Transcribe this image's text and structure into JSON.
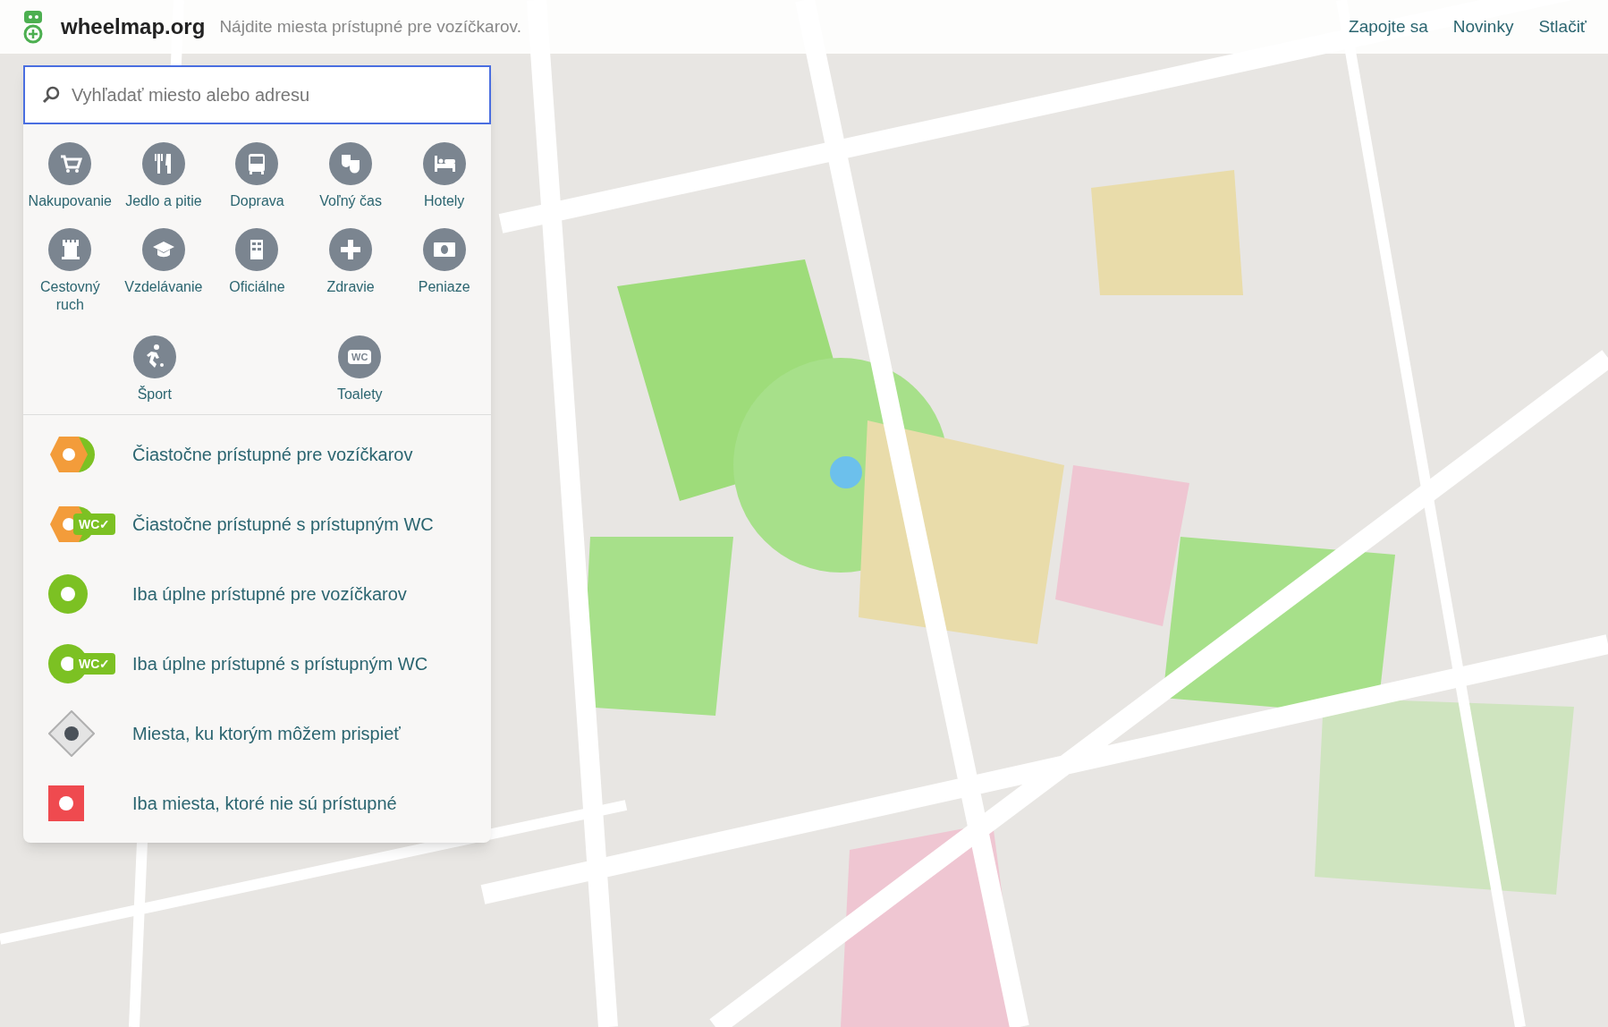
{
  "header": {
    "logo": "wheelmap.org",
    "tagline": "Nájdite miesta prístupné pre vozíčkarov.",
    "nav": [
      "Zapojte sa",
      "Novinky",
      "Stlačiť"
    ]
  },
  "search": {
    "placeholder": "Vyhľadať miesto alebo adresu"
  },
  "categories": [
    {
      "kind": "cart",
      "label": "Nakupovanie"
    },
    {
      "kind": "cutlery",
      "label": "Jedlo a pitie"
    },
    {
      "kind": "bus",
      "label": "Doprava"
    },
    {
      "kind": "masks",
      "label": "Voľný čas"
    },
    {
      "kind": "bed",
      "label": "Hotely"
    },
    {
      "kind": "tower",
      "label": "Cestovný ruch"
    },
    {
      "kind": "cap",
      "label": "Vzdelávanie"
    },
    {
      "kind": "building",
      "label": "Oficiálne"
    },
    {
      "kind": "plus",
      "label": "Zdravie"
    },
    {
      "kind": "money",
      "label": "Peniaze"
    },
    {
      "kind": "runner",
      "label": "Šport"
    },
    {
      "kind": "wc",
      "label": "Toalety",
      "icon_text": "WC"
    }
  ],
  "legend": [
    {
      "kind": "partial",
      "label": "Čiastočne prístupné pre vozíčkarov"
    },
    {
      "kind": "partial",
      "label": "Čiastočne prístupné s prístupným WC",
      "wc_badge": "WC✓"
    },
    {
      "kind": "full",
      "label": "Iba úplne prístupné pre vozíčkarov"
    },
    {
      "kind": "full",
      "label": "Iba úplne prístupné s prístupným WC",
      "wc_badge": "WC✓"
    },
    {
      "kind": "unknown",
      "label": "Miesta, ku ktorým môžem prispieť"
    },
    {
      "kind": "none",
      "label": "Iba miesta, ktoré nie sú prístupné"
    }
  ]
}
